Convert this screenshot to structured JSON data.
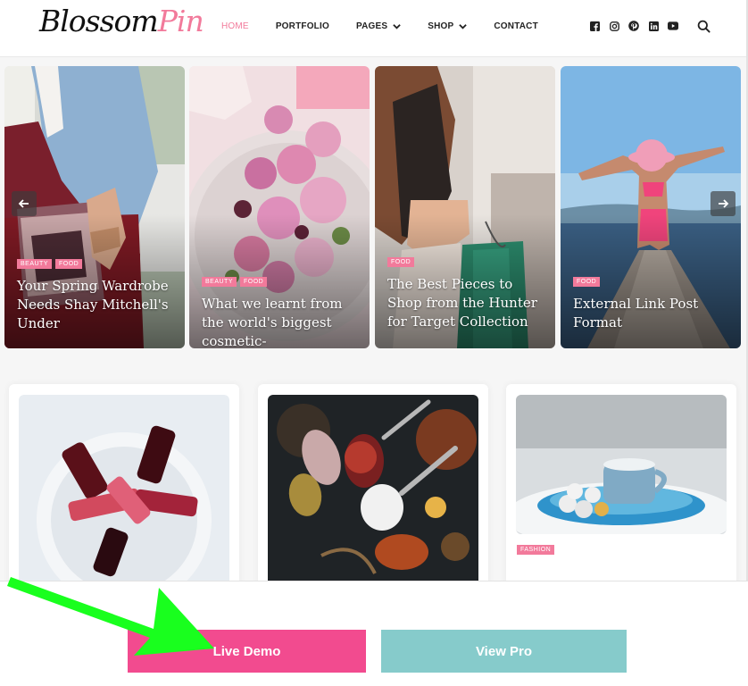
{
  "logo": {
    "part1": "Blossom",
    "part2": "Pin"
  },
  "nav": [
    {
      "label": "HOME",
      "dropdown": false,
      "active": true
    },
    {
      "label": "PORTFOLIO",
      "dropdown": false,
      "active": false
    },
    {
      "label": "PAGES",
      "dropdown": true,
      "active": false
    },
    {
      "label": "SHOP",
      "dropdown": true,
      "active": false
    },
    {
      "label": "CONTACT",
      "dropdown": false,
      "active": false
    }
  ],
  "social": [
    "facebook-icon",
    "instagram-icon",
    "pinterest-icon",
    "linkedin-icon",
    "youtube-icon"
  ],
  "slides": [
    {
      "tags": [
        "BEAUTY",
        "FOOD"
      ],
      "title": "Your Spring Wardrobe Needs Shay Mitchell's Under"
    },
    {
      "tags": [
        "BEAUTY",
        "FOOD"
      ],
      "title": "What we learnt from the world's biggest cosmetic-"
    },
    {
      "tags": [
        "FOOD"
      ],
      "title": "The Best Pieces to Shop from the Hunter for Target Collection"
    },
    {
      "tags": [
        "FOOD"
      ],
      "title": "External Link Post Format"
    }
  ],
  "cards": [
    {
      "image": "lipsticks"
    },
    {
      "image": "spices"
    },
    {
      "image": "winter-tea",
      "tag": "FASHION"
    }
  ],
  "buttons": {
    "live": "Live Demo",
    "pro": "View Pro"
  },
  "colors": {
    "accent": "#f27a9b",
    "live_button": "#f24b8f",
    "pro_button": "#86cbcb",
    "pointer_arrow": "#19ff1e"
  }
}
